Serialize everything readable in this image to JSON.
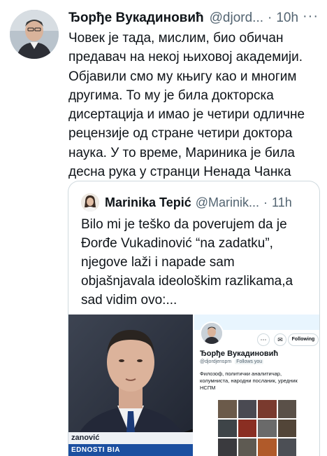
{
  "tweet": {
    "author_name": "Ђорђе Вукадиновић",
    "author_handle": "@djord...",
    "separator": "·",
    "time": "10h",
    "more": "···",
    "text": "Човек је тада, мислим, био обичан\nпредавач на некој њиховој академији.\nОбјавили смо му књигу као и многим\nдругима. То му је била докторска\nдисертација и имао је четири одличне\nрецензије од стране четири доктора\nнаука. У то време, Мариника је била\nдесна рука у странци Ненада Чанка"
  },
  "quote": {
    "author_name": "Marinika Tepić",
    "author_handle": "@Marinik...",
    "separator": "·",
    "time": "11h",
    "text": "Bilo mi je teško da poverujem da je\nĐorđe Vukadinović “na zadatku”,\nnjegove laži i napade sam\nobjašnjavala ideološkim razlikama,a\nsad vidim ovo:..."
  },
  "media": {
    "chyron_top": "zanović",
    "chyron_bottom": "EDNOSTI BIA",
    "profile": {
      "name": "Ђорђе Вукадиновић",
      "handle": "@djordjenspm",
      "follows_badge": "Follows you",
      "follow_button": "Following",
      "bio": "Филозоф, политички аналитичар,\nколумниста, народни посланик, уредник\nНСПМ",
      "icon_more": "⋯",
      "icon_message": "✉",
      "icon_notify": "🔔"
    }
  },
  "colors": {
    "text": "#0f1419",
    "secondary": "#536471",
    "border": "#cfd9de",
    "chyron_blue": "#1b4fa0"
  }
}
